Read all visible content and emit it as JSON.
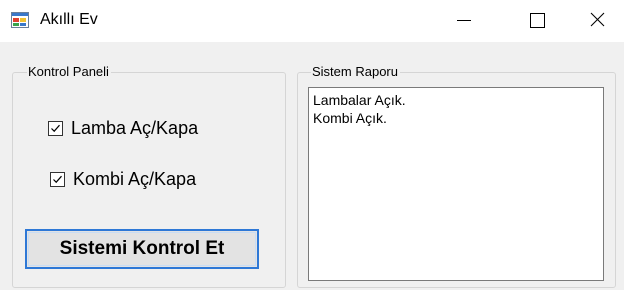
{
  "window": {
    "title": "Akıllı Ev",
    "icon": "windows-form-app-icon"
  },
  "titlebar_buttons": {
    "minimize_icon": "minimize-icon",
    "maximize_icon": "maximize-icon",
    "close_icon": "close-icon"
  },
  "control_panel": {
    "title": "Kontrol Paneli",
    "lamba": {
      "label": "Lamba Aç/Kapa",
      "checked": true
    },
    "kombi": {
      "label": "Kombi Aç/Kapa",
      "checked": true
    },
    "check_button_label": "Sistemi Kontrol Et"
  },
  "report_panel": {
    "title": "Sistem Raporu",
    "lines": [
      "Lambalar Açık.",
      "Kombi Açık."
    ]
  },
  "colors": {
    "form_background": "#f0f0f0",
    "button_focus_border": "#2e78d6",
    "groupbox_border": "#d5d5d5"
  }
}
